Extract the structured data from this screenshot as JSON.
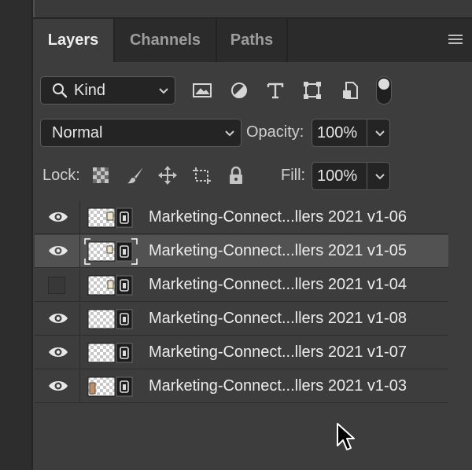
{
  "tabs": [
    {
      "label": "Layers",
      "active": true
    },
    {
      "label": "Channels",
      "active": false
    },
    {
      "label": "Paths",
      "active": false
    }
  ],
  "filter": {
    "kind_label": "Kind",
    "icons": [
      "image-filter-icon",
      "adjustment-filter-icon",
      "type-filter-icon",
      "shape-filter-icon",
      "smart-object-filter-icon"
    ],
    "toggle_on": true
  },
  "blend": {
    "mode": "Normal",
    "opacity_label": "Opacity:",
    "opacity_value": "100%"
  },
  "lock": {
    "label": "Lock:",
    "icons": [
      "lock-transparent-pixels-icon",
      "lock-image-pixels-icon",
      "lock-position-icon",
      "lock-artboard-icon",
      "lock-all-icon"
    ],
    "fill_label": "Fill:",
    "fill_value": "100%"
  },
  "layers": [
    {
      "name": "Marketing-Connect...llers 2021 v1-06",
      "visible": true,
      "selected": false
    },
    {
      "name": "Marketing-Connect...llers 2021 v1-05",
      "visible": true,
      "selected": true
    },
    {
      "name": "Marketing-Connect...llers 2021 v1-04",
      "visible": false,
      "selected": false
    },
    {
      "name": "Marketing-Connect...llers 2021 v1-08",
      "visible": true,
      "selected": false
    },
    {
      "name": "Marketing-Connect...llers 2021 v1-07",
      "visible": true,
      "selected": false
    },
    {
      "name": "Marketing-Connect...llers 2021 v1-03",
      "visible": true,
      "selected": false
    }
  ],
  "colors": {
    "panel_bg": "#3d3d3d",
    "tabbar_bg": "#2b2b2b",
    "selected_row": "#525252",
    "field_bg": "#242424"
  }
}
